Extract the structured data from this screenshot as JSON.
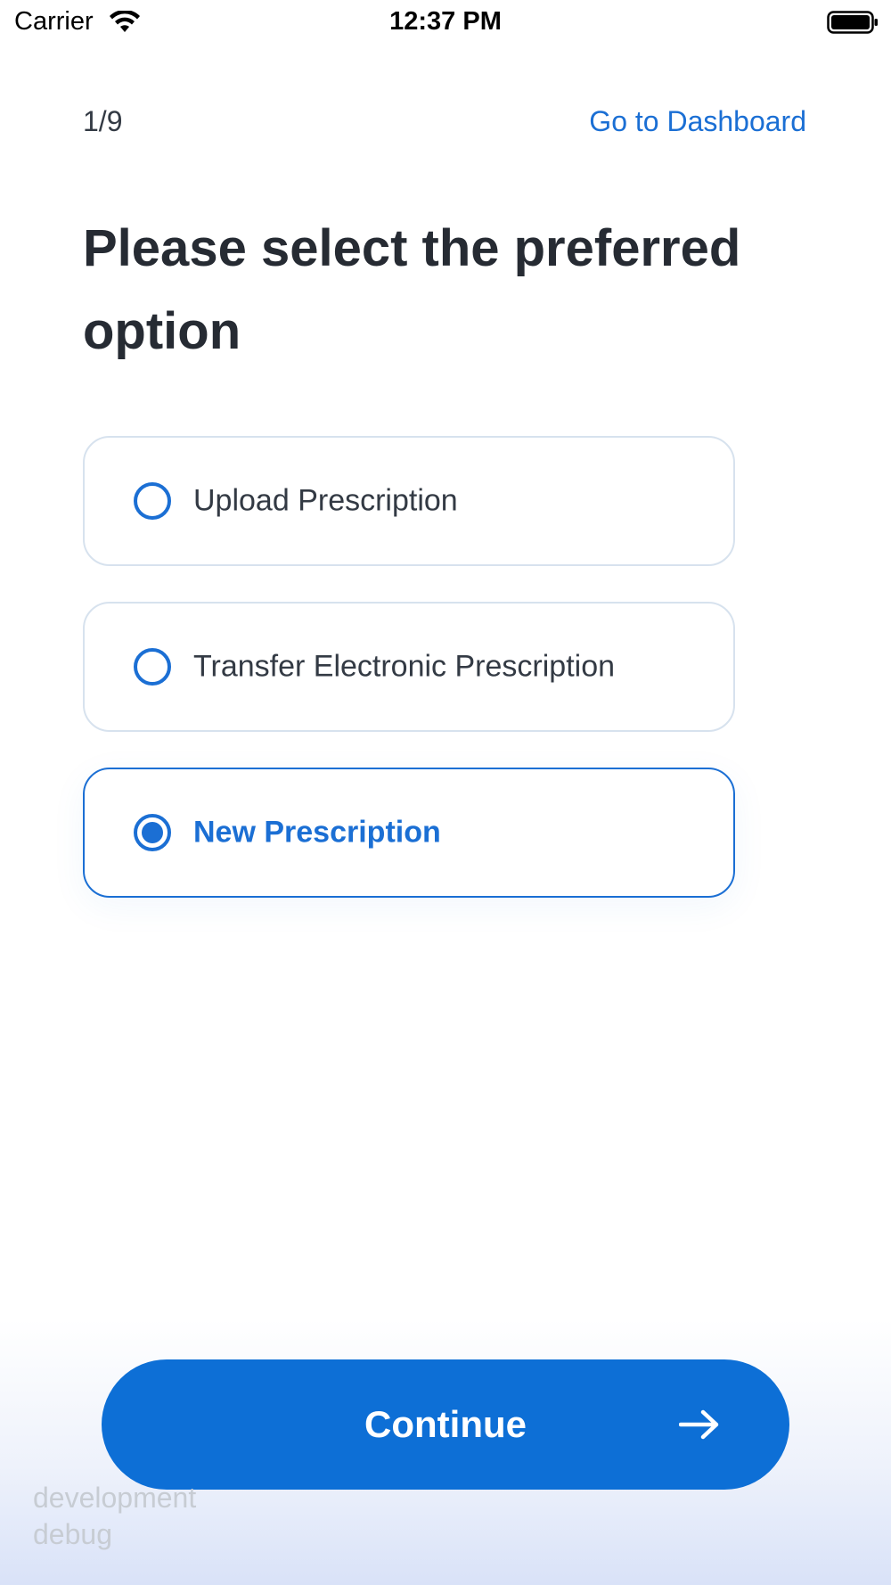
{
  "status_bar": {
    "carrier": "Carrier",
    "time": "12:37 PM",
    "wifi_icon": "wifi-icon",
    "battery_icon": "battery-icon"
  },
  "header": {
    "step": "1/9",
    "dashboard_link": "Go to Dashboard"
  },
  "title": "Please select the preferred option",
  "options": [
    {
      "label": "Upload Prescription",
      "selected": false
    },
    {
      "label": "Transfer Electronic Prescription",
      "selected": false
    },
    {
      "label": "New Prescription",
      "selected": true
    }
  ],
  "footer": {
    "continue_label": "Continue",
    "continue_icon": "arrow-right-icon",
    "env_line1": "development",
    "env_line2": "debug"
  },
  "colors": {
    "accent": "#1b6fd4",
    "button": "#0d6fd6",
    "title_text": "#262b33",
    "option_border": "#d7e2ee"
  }
}
